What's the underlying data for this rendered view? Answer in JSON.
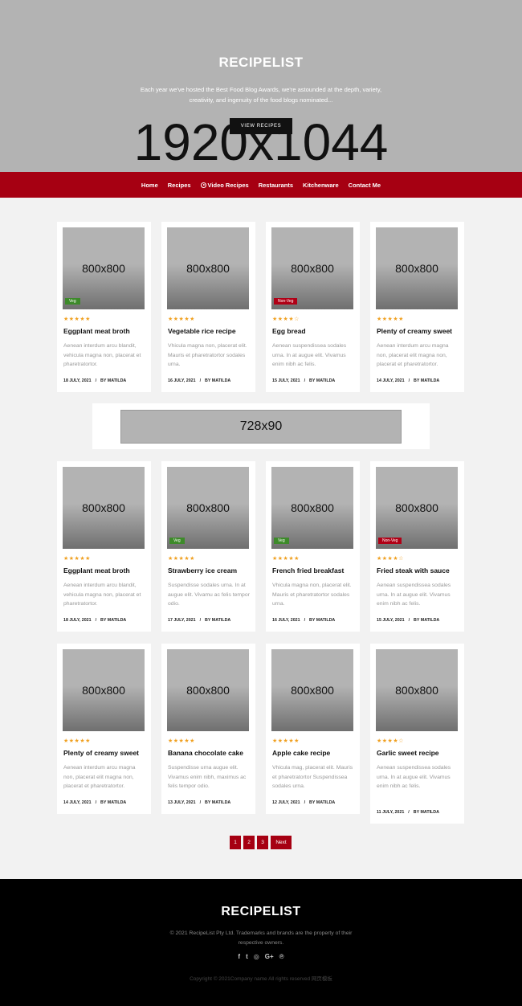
{
  "hero": {
    "title": "RECIPELIST",
    "subtitle": "Each year we've hosted the Best Food Blog Awards, we're astounded at the depth, variety, creativity, and ingenuity of the food blogs nominated...",
    "image_placeholder": "1920x1044",
    "button_label": "VIEW RECIPES",
    "background_color": "#b3b3b3"
  },
  "nav": {
    "background_color": "#a60012",
    "items": [
      {
        "label": "Home",
        "icon": null
      },
      {
        "label": "Recipes",
        "icon": null
      },
      {
        "label": "Video Recipes",
        "icon": "play-circle-icon"
      },
      {
        "label": "Restaurants",
        "icon": null
      },
      {
        "label": "Kitchenware",
        "icon": null
      },
      {
        "label": "Contact Me",
        "icon": null
      }
    ]
  },
  "ad": {
    "placeholder": "728x90"
  },
  "rows": [
    [
      {
        "image": "800x800",
        "badge": "Veg",
        "badge_type": "veg",
        "stars": "★★★★★",
        "title": "Eggplant meat broth",
        "desc": "Aenean interdum arcu blandit, vehicula magna non, placerat et pharetratortor.",
        "date": "18 JULY, 2021",
        "author": "BY MATILDA"
      },
      {
        "image": "800x800",
        "badge": null,
        "badge_type": null,
        "stars": "★★★★★",
        "title": "Vegetable rice recipe",
        "desc": "Vhicula magna non, placerat elit. Mauris et pharetratortor sodales urna.",
        "date": "16 JULY, 2021",
        "author": "BY MATILDA"
      },
      {
        "image": "800x800",
        "badge": "Non-Veg",
        "badge_type": "nonveg",
        "stars": "★★★★☆",
        "title": "Egg bread",
        "desc": "Aenean suspendissea sodales urna. In at augue elit. Vivamus enim nibh ac felis.",
        "date": "15 JULY, 2021",
        "author": "BY MATILDA"
      },
      {
        "image": "800x800",
        "badge": null,
        "badge_type": null,
        "stars": "★★★★★",
        "title": "Plenty of creamy sweet",
        "desc": "Aenean interdum arcu magna non, placerat elit magna non, placerat et pharetratortor.",
        "date": "14 JULY, 2021",
        "author": "BY MATILDA"
      }
    ],
    [
      {
        "image": "800x800",
        "badge": null,
        "badge_type": null,
        "stars": "★★★★★",
        "title": "Eggplant meat broth",
        "desc": "Aenean interdum arcu blandit, vehicula magna non, placerat et pharetratortor.",
        "date": "18 JULY, 2021",
        "author": "BY MATILDA"
      },
      {
        "image": "800x800",
        "badge": "Veg",
        "badge_type": "veg",
        "stars": "★★★★★",
        "title": "Strawberry ice cream",
        "desc": "Suspendisse sodales urna. In at augue elit. Vivamu ac felis tempor odio.",
        "date": "17 JULY, 2021",
        "author": "BY MATILDA"
      },
      {
        "image": "800x800",
        "badge": "Veg",
        "badge_type": "veg",
        "stars": "★★★★★",
        "title": "French fried breakfast",
        "desc": "Vhicula magna non, placerat elit. Mauris et pharetratortor sodales urna.",
        "date": "16 JULY, 2021",
        "author": "BY MATILDA"
      },
      {
        "image": "800x800",
        "badge": "Non-Veg",
        "badge_type": "nonveg",
        "stars": "★★★★☆",
        "title": "Fried steak with sauce",
        "desc": "Aenean suspendissea sodales urna. In at augue elit. Vivamus enim nibh ac felis.",
        "date": "15 JULY, 2021",
        "author": "BY MATILDA"
      }
    ],
    [
      {
        "image": "800x800",
        "badge": null,
        "badge_type": null,
        "stars": "★★★★★",
        "title": "Plenty of creamy sweet",
        "desc": "Aenean interdum arcu magna non, placerat elit magna non, placerat et pharetratortor.",
        "date": "14 JULY, 2021",
        "author": "BY MATILDA"
      },
      {
        "image": "800x800",
        "badge": null,
        "badge_type": null,
        "stars": "★★★★★",
        "title": "Banana chocolate cake",
        "desc": "Suspendisse urna augue elit. Vivamus enim nibh, maximus ac felis tempor odio.",
        "date": "13 JULY, 2021",
        "author": "BY MATILDA"
      },
      {
        "image": "800x800",
        "badge": null,
        "badge_type": null,
        "stars": "★★★★★",
        "title": "Apple cake recipe",
        "desc": "Vhicula mag, placerat elit. Mauris et pharetratortor Suspendissea sodales urna.",
        "date": "12 JULY, 2021",
        "author": "BY MATILDA"
      },
      {
        "image": "800x800",
        "badge": null,
        "badge_type": null,
        "stars": "★★★★☆",
        "title": "Garlic sweet recipe",
        "desc": "Aenean suspendissea sodales urna. In at augue elit. Vivamus enim nibh ac felis.",
        "date": "11 JULY, 2021",
        "author": "BY MATILDA"
      }
    ]
  ],
  "pagination": {
    "pages": [
      "1",
      "2",
      "3"
    ],
    "next_label": "Next"
  },
  "footer": {
    "title": "RECIPELIST",
    "copyright": "© 2021 RecipeList Pty Ltd. Trademarks and brands are the property of their respective owners.",
    "social": [
      {
        "icon": "facebook-icon",
        "glyph": "f"
      },
      {
        "icon": "twitter-icon",
        "glyph": "t"
      },
      {
        "icon": "instagram-icon",
        "glyph": "◎"
      },
      {
        "icon": "google-plus-icon",
        "glyph": "G+"
      },
      {
        "icon": "pinterest-icon",
        "glyph": "℗"
      }
    ],
    "bottom_text": "Copyright © 2021Company name All rights reserved 网页模板"
  }
}
